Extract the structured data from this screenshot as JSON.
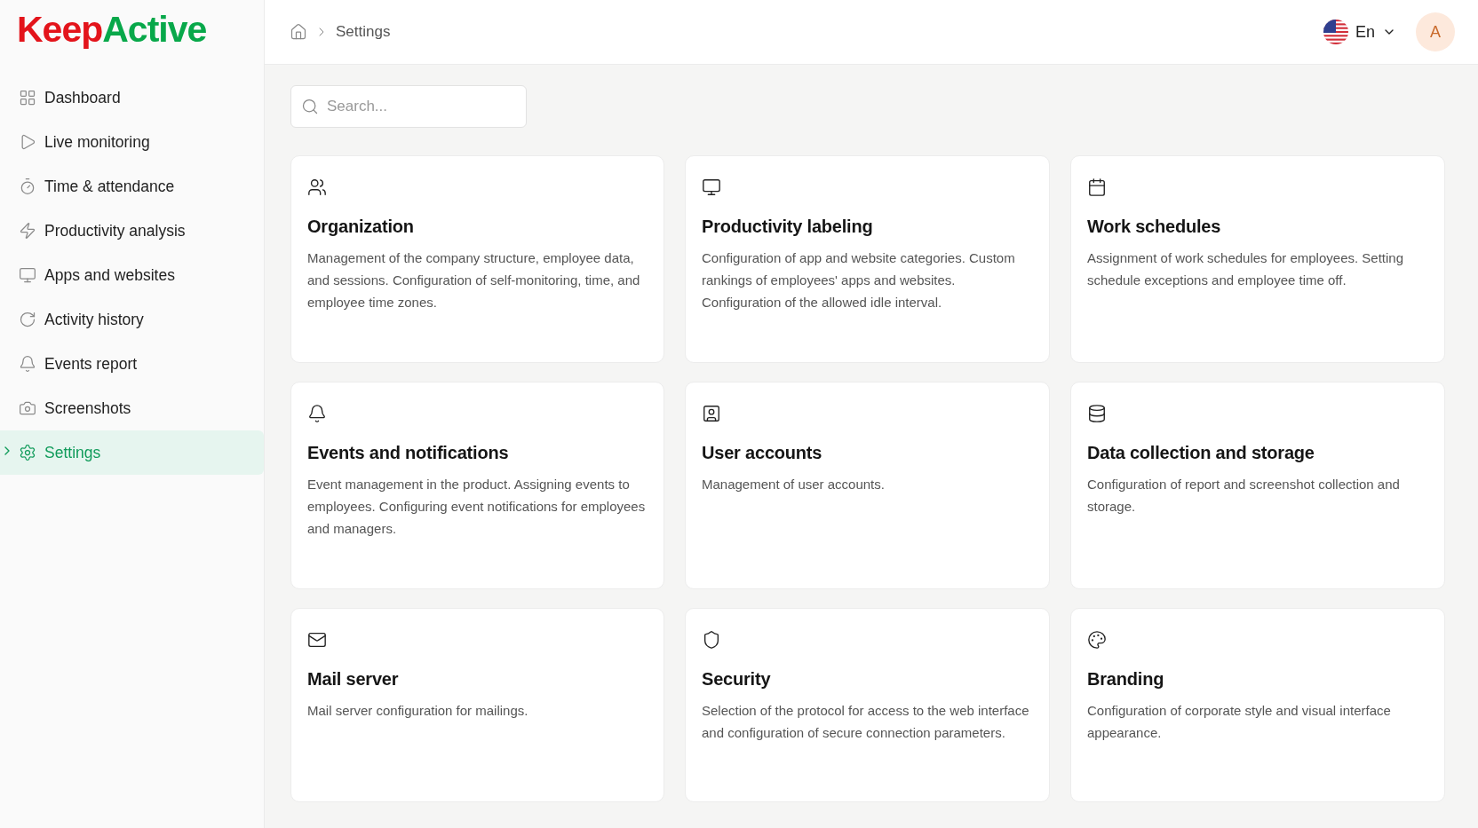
{
  "logo": [
    {
      "text": "Keep",
      "color": "#e3141b"
    },
    {
      "text": "Active",
      "color": "#08a84a"
    }
  ],
  "sidebar": {
    "items": [
      {
        "label": "Dashboard",
        "selected": false
      },
      {
        "label": "Live monitoring",
        "selected": false
      },
      {
        "label": "Time & attendance",
        "selected": false
      },
      {
        "label": "Productivity analysis",
        "selected": false
      },
      {
        "label": "Apps and websites",
        "selected": false
      },
      {
        "label": "Activity history",
        "selected": false
      },
      {
        "label": "Events report",
        "selected": false
      },
      {
        "label": "Screenshots",
        "selected": false
      },
      {
        "label": "Settings",
        "selected": true
      }
    ]
  },
  "breadcrumb": [
    "Settings"
  ],
  "language": "En",
  "avatar": "A",
  "search": {
    "placeholder": "Search..."
  },
  "cards": [
    {
      "title": "Organization",
      "description": "Management of the company structure, employee data, and sessions. Configuration of self-monitoring, time, and employee time zones."
    },
    {
      "title": "Productivity labeling",
      "description": "Configuration of app and website categories. Custom rankings of employees' apps and websites. Configuration of the allowed idle interval."
    },
    {
      "title": "Work schedules",
      "description": "Assignment of work schedules for employees. Setting schedule exceptions and employee time off."
    },
    {
      "title": "Events and notifications",
      "description": "Event management in the product. Assigning events to employees. Configuring event notifications for employees and managers."
    },
    {
      "title": "User accounts",
      "description": "Management of user accounts."
    },
    {
      "title": "Data collection and storage",
      "description": "Configuration of report and screenshot collection and storage."
    },
    {
      "title": "Mail server",
      "description": "Mail server configuration for mailings."
    },
    {
      "title": "Security",
      "description": "Selection of the protocol for access to the web interface and configuration of secure connection parameters."
    },
    {
      "title": "Branding",
      "description": "Configuration of corporate style and visual interface appearance."
    }
  ]
}
